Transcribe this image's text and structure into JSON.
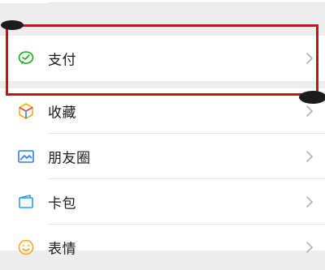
{
  "menu": {
    "items": [
      {
        "label": "支付",
        "icon": "wechat-pay-icon",
        "color": "#1AAD19"
      },
      {
        "label": "收藏",
        "icon": "favorites-cube-icon",
        "color": "#F5B11A"
      },
      {
        "label": "朋友圈",
        "icon": "moments-picture-icon",
        "color": "#2F7CF6"
      },
      {
        "label": "卡包",
        "icon": "card-wallet-icon",
        "color": "#2A9DF4"
      },
      {
        "label": "表情",
        "icon": "emoji-smile-icon",
        "color": "#F5A623"
      }
    ],
    "chevron_color": "#b2b2b2"
  },
  "annotation": {
    "highlight_color": "#c0141c",
    "highlight_target": "支付"
  }
}
